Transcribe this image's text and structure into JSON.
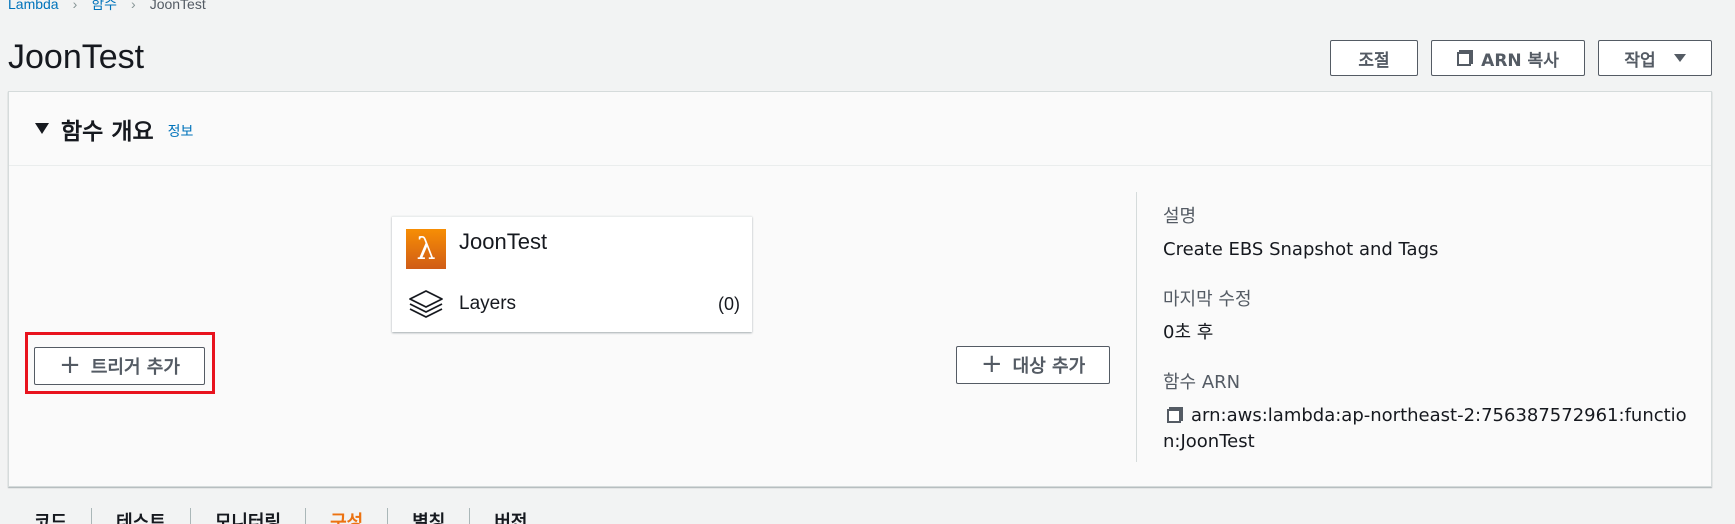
{
  "breadcrumb": {
    "item1": "Lambda",
    "item2": "함수",
    "current": "JoonTest"
  },
  "page": {
    "title": "JoonTest"
  },
  "header_buttons": {
    "adjust": "조절",
    "copy_arn": "ARN 복사",
    "actions": "작업"
  },
  "overview": {
    "title": "함수 개요",
    "info": "정보",
    "function_name": "JoonTest",
    "layers_label": "Layers",
    "layers_count": "(0)",
    "add_trigger": "트리거 추가",
    "add_destination": "대상 추가"
  },
  "details": {
    "description_label": "설명",
    "description_value": "Create EBS Snapshot and Tags",
    "last_modified_label": "마지막 수정",
    "last_modified_value": "0초 후",
    "arn_label": "함수 ARN",
    "arn_value": "arn:aws:lambda:ap-northeast-2:756387572961:function:JoonTest"
  },
  "tabs": [
    "코드",
    "테스트",
    "모니터링",
    "구성",
    "별칭",
    "버전"
  ],
  "colors": {
    "accent": "#ec7211",
    "link": "#0073bb",
    "highlight": "#e8131e",
    "lambda": "#f78e04"
  },
  "icons": {
    "copy": "copy-icon",
    "lambda": "lambda-icon",
    "layers": "layers-icon",
    "plus": "plus-icon",
    "caret": "caret-down-icon"
  }
}
